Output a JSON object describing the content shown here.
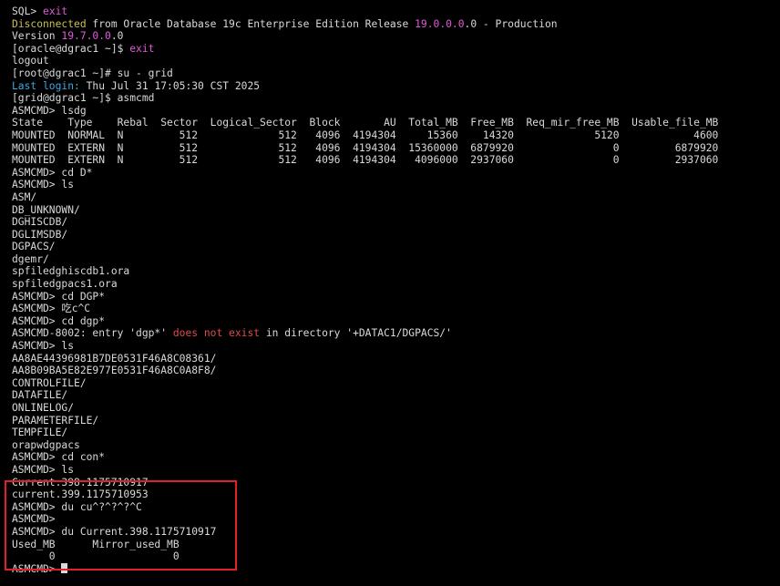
{
  "terminal": {
    "lines": [
      [
        {
          "t": "SQL> "
        },
        {
          "t": "exit",
          "c": "magenta"
        }
      ],
      [
        {
          "t": "Disconnected",
          "c": "green"
        },
        {
          "t": " from Oracle Database 19c Enterprise Edition Release "
        },
        {
          "t": "19.0.0.0",
          "c": "magenta"
        },
        {
          "t": ".0 - Production"
        }
      ],
      [
        {
          "t": "Version "
        },
        {
          "t": "19.7.0.0",
          "c": "magenta"
        },
        {
          "t": ".0"
        }
      ],
      [
        {
          "t": "[oracle@dgrac1 ~]$ "
        },
        {
          "t": "exit",
          "c": "magenta"
        }
      ],
      [
        {
          "t": "logout"
        }
      ],
      [
        {
          "t": "[root@dgrac1 ~]# su - grid"
        }
      ],
      [
        {
          "t": "Last login:",
          "c": "blue"
        },
        {
          "t": " Thu Jul 31 17:05:30 CST 2025"
        }
      ],
      [
        {
          "t": "[grid@dgrac1 ~]$ asmcmd"
        }
      ],
      [
        {
          "t": "ASMCMD> lsdg"
        }
      ],
      [
        {
          "t": "State    Type    Rebal  Sector  Logical_Sector  Block       AU  Total_MB  Free_MB  Req_mir_free_MB  Usable_file_MB"
        }
      ],
      [
        {
          "t": "MOUNTED  NORMAL  N         512             512   4096  4194304     15360    14320             5120            4600"
        }
      ],
      [
        {
          "t": "MOUNTED  EXTERN  N         512             512   4096  4194304  15360000  6879920                0         6879920"
        }
      ],
      [
        {
          "t": "MOUNTED  EXTERN  N         512             512   4096  4194304   4096000  2937060                0         2937060"
        }
      ],
      [
        {
          "t": "ASMCMD> cd D*"
        }
      ],
      [
        {
          "t": "ASMCMD> ls"
        }
      ],
      [
        {
          "t": "ASM/"
        }
      ],
      [
        {
          "t": "DB_UNKNOWN/"
        }
      ],
      [
        {
          "t": "DGHISCDB/"
        }
      ],
      [
        {
          "t": "DGLIMSDB/"
        }
      ],
      [
        {
          "t": "DGPACS/"
        }
      ],
      [
        {
          "t": "dgemr/"
        }
      ],
      [
        {
          "t": "spfiledghiscdb1.ora"
        }
      ],
      [
        {
          "t": "spfiledgpacs1.ora"
        }
      ],
      [
        {
          "t": "ASMCMD> cd DGP*"
        }
      ],
      [
        {
          "t": "ASMCMD> 吃c^C"
        }
      ],
      [
        {
          "t": "ASMCMD> cd dgp*"
        }
      ],
      [
        {
          "t": "ASMCMD-8002: entry 'dgp*' "
        },
        {
          "t": "does not exist",
          "c": "red"
        },
        {
          "t": " in directory '+DATAC1/DGPACS/'"
        }
      ],
      [
        {
          "t": "ASMCMD> ls"
        }
      ],
      [
        {
          "t": "AA8AE44396981B7DE0531F46A8C08361/"
        }
      ],
      [
        {
          "t": "AA8B09BA5E82E977E0531F46A8C0A8F8/"
        }
      ],
      [
        {
          "t": "CONTROLFILE/"
        }
      ],
      [
        {
          "t": "DATAFILE/"
        }
      ],
      [
        {
          "t": "ONLINELOG/"
        }
      ],
      [
        {
          "t": "PARAMETERFILE/"
        }
      ],
      [
        {
          "t": "TEMPFILE/"
        }
      ],
      [
        {
          "t": "orapwdgpacs"
        }
      ],
      [
        {
          "t": "ASMCMD> cd con*"
        }
      ],
      [
        {
          "t": "ASMCMD> ls"
        }
      ],
      [
        {
          "t": "Current.398.1175710917"
        }
      ],
      [
        {
          "t": "current.399.1175710953"
        }
      ],
      [
        {
          "t": "ASMCMD> du cu^?^?^?^C"
        }
      ],
      [
        {
          "t": "ASMCMD>"
        }
      ],
      [
        {
          "t": "ASMCMD> du Current.398.1175710917"
        }
      ],
      [
        {
          "t": "Used_MB      Mirror_used_MB"
        }
      ],
      [
        {
          "t": "      0                   0"
        }
      ],
      [
        {
          "t": "ASMCMD> "
        }
      ]
    ],
    "colors": {
      "background": "#000000",
      "default": "#d9d9d9",
      "green": "#c7c04f",
      "magenta": "#e25ad8",
      "red": "#e04a4a",
      "blue": "#3ea7e0",
      "highlight_border": "#e0202a"
    }
  }
}
